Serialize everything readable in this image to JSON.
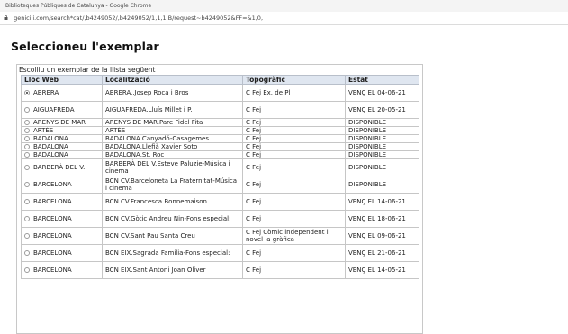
{
  "window": {
    "title": "Biblioteques Públiques de Catalunya - Google Chrome"
  },
  "address_bar": {
    "url": "genicili.com/search*cat/,b4249052/,b4249052/1,1,1,B/request~b4249052&FF=&1,0,"
  },
  "page": {
    "title": "Seleccioneu l'exemplar",
    "caption": "Escolliu un exemplar de la llista següent"
  },
  "table": {
    "headers": [
      "Lloc Web",
      "Localització",
      "Topogràfic",
      "Estat"
    ],
    "rows": [
      {
        "selected": true,
        "lloc": "ABRERA",
        "loc": "ABRERA..Josep Roca i Bros",
        "top": "C Fej Ex. de Pl",
        "estat": "VENÇ EL 04-06-21"
      },
      {
        "selected": false,
        "lloc": "AIGUAFREDA",
        "loc": "AIGUAFREDA.Lluís Millet i P.",
        "top": "C Fej",
        "estat": "VENÇ EL 20-05-21"
      },
      {
        "selected": false,
        "lloc": "ARENYS DE MAR",
        "loc": "ARENYS DE MAR.Pare Fidel Fita",
        "top": "C Fej",
        "estat": "DISPONIBLE"
      },
      {
        "selected": false,
        "lloc": "ARTÉS",
        "loc": "ARTÉS",
        "top": "C Fej",
        "estat": "DISPONIBLE"
      },
      {
        "selected": false,
        "lloc": "BADALONA",
        "loc": "BADALONA.Canyadó-Casagemes",
        "top": "C Fej",
        "estat": "DISPONIBLE"
      },
      {
        "selected": false,
        "lloc": "BADALONA",
        "loc": "BADALONA.Llefià Xavier Soto",
        "top": "C Fej",
        "estat": "DISPONIBLE"
      },
      {
        "selected": false,
        "lloc": "BADALONA",
        "loc": "BADALONA.St. Roc",
        "top": "C Fej",
        "estat": "DISPONIBLE"
      },
      {
        "selected": false,
        "lloc": "BARBERÀ DEL V.",
        "loc": "BARBERÀ DEL V.Esteve Paluzie-Música i cinema",
        "top": "C Fej",
        "estat": "DISPONIBLE"
      },
      {
        "selected": false,
        "lloc": "BARCELONA",
        "loc": "BCN CV.Barceloneta La Fraternitat-Música i cinema",
        "top": "C Fej",
        "estat": "DISPONIBLE"
      },
      {
        "selected": false,
        "lloc": "BARCELONA",
        "loc": "BCN CV.Francesca Bonnemaison",
        "top": "C Fej",
        "estat": "VENÇ EL 14-06-21"
      },
      {
        "selected": false,
        "lloc": "BARCELONA",
        "loc": "BCN CV.Gòtic Andreu Nin-Fons especial:",
        "top": "C Fej",
        "estat": "VENÇ EL 18-06-21"
      },
      {
        "selected": false,
        "lloc": "BARCELONA",
        "loc": "BCN CV.Sant Pau Santa Creu",
        "top": "C Fej Còmic independent i novel·la gràfica",
        "estat": "VENÇ EL 09-06-21"
      },
      {
        "selected": false,
        "lloc": "BARCELONA",
        "loc": "BCN EIX.Sagrada Família-Fons especial:",
        "top": "C Fej",
        "estat": "VENÇ EL 21-06-21"
      },
      {
        "selected": false,
        "lloc": "BARCELONA",
        "loc": "BCN EIX.Sant Antoni Joan Oliver",
        "top": "C Fej",
        "estat": "VENÇ EL 14-05-21"
      }
    ]
  }
}
